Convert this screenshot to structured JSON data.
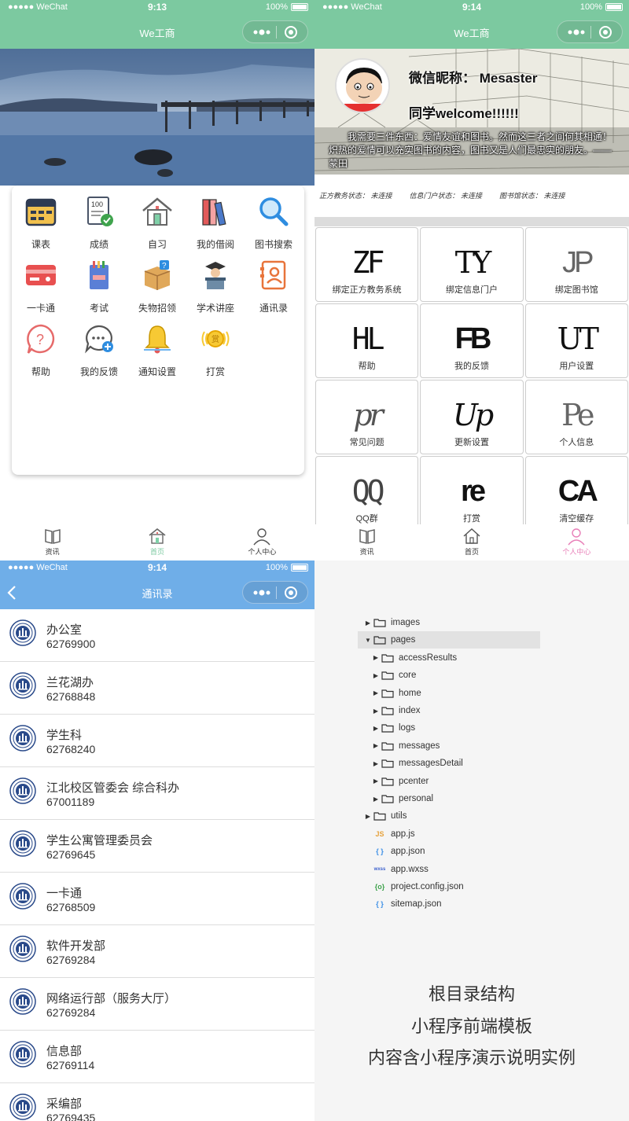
{
  "q1": {
    "status": {
      "carrier": "●●●●● WeChat",
      "time": "9:13",
      "battery": "100%"
    },
    "nav": {
      "title": "We工商"
    },
    "grid": [
      {
        "label": "课表",
        "icon": "calendar-icon"
      },
      {
        "label": "成绩",
        "icon": "score-icon"
      },
      {
        "label": "自习",
        "icon": "house-icon"
      },
      {
        "label": "我的借阅",
        "icon": "books-icon"
      },
      {
        "label": "图书搜索",
        "icon": "search-icon"
      },
      {
        "label": "一卡通",
        "icon": "card-icon"
      },
      {
        "label": "考试",
        "icon": "exam-icon"
      },
      {
        "label": "失物招领",
        "icon": "box-icon"
      },
      {
        "label": "学术讲座",
        "icon": "lecture-icon"
      },
      {
        "label": "通讯录",
        "icon": "contacts-icon"
      },
      {
        "label": "帮助",
        "icon": "help-icon"
      },
      {
        "label": "我的反馈",
        "icon": "feedback-icon"
      },
      {
        "label": "通知设置",
        "icon": "bell-icon"
      },
      {
        "label": "打赏",
        "icon": "reward-icon"
      }
    ],
    "tabs": [
      "资讯",
      "首页",
      "个人中心"
    ]
  },
  "q2": {
    "status": {
      "carrier": "●●●●● WeChat",
      "time": "9:14",
      "battery": "100%"
    },
    "nav": {
      "title": "We工商"
    },
    "banner": {
      "nickname": "微信昵称： Mesaster",
      "welcome": "同学welcome!!!!!!",
      "quote": "我需要三件东西：爱情友谊和图书。然而这三者之间何其相通！炽热的爱情可以充实图书的内容，图书又是人们最忠实的朋友。——蒙田"
    },
    "statuses": [
      "正方教务状态： 未连接",
      "信息门户状态： 未连接",
      "图书馆状态： 未连接"
    ],
    "grid": [
      {
        "mono": "ZF",
        "label": "绑定正方教务系统"
      },
      {
        "mono": "TY",
        "label": "绑定信息门户"
      },
      {
        "mono": "JP",
        "label": "绑定图书馆"
      },
      {
        "mono": "HL",
        "label": "帮助"
      },
      {
        "mono": "FB",
        "label": "我的反馈"
      },
      {
        "mono": "UT",
        "label": "用户设置"
      },
      {
        "mono": "pr",
        "label": "常见问题"
      },
      {
        "mono": "Up",
        "label": "更新设置"
      },
      {
        "mono": "Pe",
        "label": "个人信息"
      },
      {
        "mono": "QQ",
        "label": "QQ群"
      },
      {
        "mono": "re",
        "label": "打赏"
      },
      {
        "mono": "CA",
        "label": "清空缓存"
      }
    ],
    "tabs": [
      "资讯",
      "首页",
      "个人中心"
    ],
    "accent": "#e87fb8"
  },
  "q3": {
    "status": {
      "carrier": "●●●●● WeChat",
      "time": "9:14",
      "battery": "100%"
    },
    "nav": {
      "title": "通讯录"
    },
    "contacts": [
      {
        "name": "办公室",
        "phone": "62769900"
      },
      {
        "name": "兰花湖办",
        "phone": "62768848"
      },
      {
        "name": "学生科",
        "phone": "62768240"
      },
      {
        "name": "江北校区管委会 综合科办",
        "phone": "67001189"
      },
      {
        "name": "学生公寓管理委员会",
        "phone": "62769645"
      },
      {
        "name": "一卡通",
        "phone": "62768509"
      },
      {
        "name": "软件开发部",
        "phone": "62769284"
      },
      {
        "name": "网络运行部（服务大厅）",
        "phone": "62769284"
      },
      {
        "name": "信息部",
        "phone": "62769114"
      },
      {
        "name": "采编部",
        "phone": "62769435"
      }
    ]
  },
  "q4": {
    "tree": [
      {
        "name": "images",
        "kind": "folder",
        "depth": 0,
        "open": false
      },
      {
        "name": "pages",
        "kind": "folder",
        "depth": 0,
        "open": true,
        "selected": true
      },
      {
        "name": "accessResults",
        "kind": "folder",
        "depth": 1,
        "open": false
      },
      {
        "name": "core",
        "kind": "folder",
        "depth": 1,
        "open": false
      },
      {
        "name": "home",
        "kind": "folder",
        "depth": 1,
        "open": false
      },
      {
        "name": "index",
        "kind": "folder",
        "depth": 1,
        "open": false
      },
      {
        "name": "logs",
        "kind": "folder",
        "depth": 1,
        "open": false
      },
      {
        "name": "messages",
        "kind": "folder",
        "depth": 1,
        "open": false
      },
      {
        "name": "messagesDetail",
        "kind": "folder",
        "depth": 1,
        "open": false
      },
      {
        "name": "pcenter",
        "kind": "folder",
        "depth": 1,
        "open": false
      },
      {
        "name": "personal",
        "kind": "folder",
        "depth": 1,
        "open": false
      },
      {
        "name": "utils",
        "kind": "folder",
        "depth": 0,
        "open": false
      },
      {
        "name": "app.js",
        "kind": "js",
        "depth": 0,
        "badge": "JS"
      },
      {
        "name": "app.json",
        "kind": "json",
        "depth": 0,
        "badge": "{ }"
      },
      {
        "name": "app.wxss",
        "kind": "wxss",
        "depth": 0,
        "badge": "wxss"
      },
      {
        "name": "project.config.json",
        "kind": "config",
        "depth": 0,
        "badge": "{o}"
      },
      {
        "name": "sitemap.json",
        "kind": "json",
        "depth": 0,
        "badge": "{ }"
      }
    ],
    "captions": [
      "根目录结构",
      "小程序前端模板",
      "内容含小程序演示说明实例"
    ]
  },
  "colors": {
    "green": "#7cc9a0",
    "blue": "#6faee8",
    "pink": "#e87fb8"
  }
}
